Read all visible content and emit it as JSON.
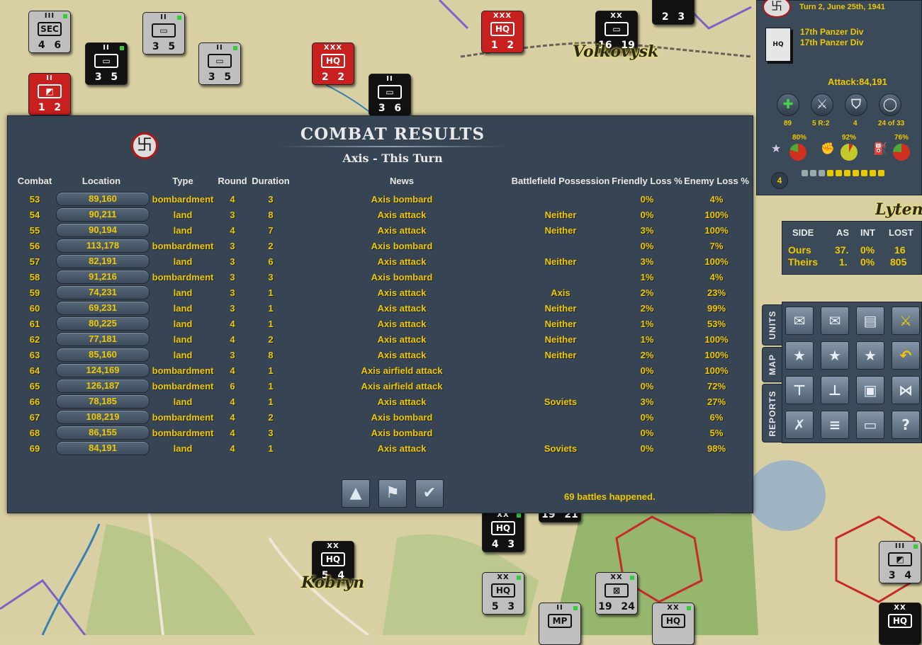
{
  "top_info": {
    "turn": "Turn 2, June 25th, 1941",
    "unit_line1": "17th Panzer Div",
    "unit_line2": "17th Panzer Div",
    "attack": "Attack:84,191",
    "stats": [
      {
        "icon": "medic-cross-icon",
        "value": "89"
      },
      {
        "icon": "crossed-swords-icon",
        "value": "5 R:2"
      },
      {
        "icon": "shield-icon",
        "value": "4"
      },
      {
        "icon": "circle-icon",
        "value": "24 of 33"
      }
    ],
    "pcts": [
      "80%",
      "92%",
      "76%"
    ],
    "count": "4"
  },
  "map": {
    "cities": [
      "Volkovysk",
      "Kobryn",
      "Lyten"
    ],
    "counters": [
      {
        "size": "III",
        "sym": "SEC",
        "nums": "4 6",
        "color": "grey"
      },
      {
        "size": "II",
        "sym": "▭",
        "nums": "3 5",
        "color": "grey"
      },
      {
        "size": "XXX",
        "sym": "HQ",
        "nums": "1 2",
        "color": "red"
      },
      {
        "size": "XX",
        "sym": "▭",
        "nums": "16 19",
        "color": "black"
      },
      {
        "size": "",
        "sym": "",
        "nums": "2 3",
        "color": "black"
      },
      {
        "size": "II",
        "sym": "▭",
        "nums": "3 5",
        "color": "black"
      },
      {
        "size": "II",
        "sym": "▭",
        "nums": "3 5",
        "color": "grey"
      },
      {
        "size": "XXX",
        "sym": "HQ",
        "nums": "2 2",
        "color": "red"
      },
      {
        "size": "II",
        "sym": "▭",
        "nums": "3 6",
        "color": "black"
      },
      {
        "size": "II",
        "sym": "◩",
        "nums": "1 2",
        "color": "red"
      },
      {
        "size": "XX",
        "sym": "HQ",
        "nums": "4 3",
        "color": "black"
      },
      {
        "size": "",
        "sym": "",
        "nums": "19 21",
        "color": "black"
      },
      {
        "size": "XX",
        "sym": "HQ",
        "nums": "5 4",
        "color": "black"
      },
      {
        "size": "XX",
        "sym": "HQ",
        "nums": "5 3",
        "color": "grey"
      },
      {
        "size": "II",
        "sym": "MP",
        "nums": "",
        "color": "grey"
      },
      {
        "size": "XX",
        "sym": "⊠",
        "nums": "19 24",
        "color": "grey"
      },
      {
        "size": "XX",
        "sym": "HQ",
        "nums": "",
        "color": "grey"
      },
      {
        "size": "III",
        "sym": "◩",
        "nums": "3 4",
        "color": "grey"
      },
      {
        "size": "XX",
        "sym": "HQ",
        "nums": "",
        "color": "black"
      }
    ]
  },
  "combat": {
    "title": "COMBAT RESULTS",
    "subtitle": "Axis - This Turn",
    "headers": [
      "Combat",
      "Location",
      "Type",
      "Round",
      "Duration",
      "News",
      "Battlefield Possession",
      "Friendly Loss %",
      "Enemy Loss %"
    ],
    "rows": [
      [
        "53",
        "89,160",
        "bombardment",
        "4",
        "3",
        "Axis bombard",
        "",
        "0%",
        "4%"
      ],
      [
        "54",
        "90,211",
        "land",
        "3",
        "8",
        "Axis attack",
        "Neither",
        "0%",
        "100%"
      ],
      [
        "55",
        "90,194",
        "land",
        "4",
        "7",
        "Axis attack",
        "Neither",
        "3%",
        "100%"
      ],
      [
        "56",
        "113,178",
        "bombardment",
        "3",
        "2",
        "Axis bombard",
        "",
        "0%",
        "7%"
      ],
      [
        "57",
        "82,191",
        "land",
        "3",
        "6",
        "Axis attack",
        "Neither",
        "3%",
        "100%"
      ],
      [
        "58",
        "91,216",
        "bombardment",
        "3",
        "3",
        "Axis bombard",
        "",
        "1%",
        "4%"
      ],
      [
        "59",
        "74,231",
        "land",
        "3",
        "1",
        "Axis attack",
        "Axis",
        "2%",
        "23%"
      ],
      [
        "60",
        "69,231",
        "land",
        "3",
        "1",
        "Axis attack",
        "Neither",
        "2%",
        "99%"
      ],
      [
        "61",
        "80,225",
        "land",
        "4",
        "1",
        "Axis attack",
        "Neither",
        "1%",
        "53%"
      ],
      [
        "62",
        "77,181",
        "land",
        "4",
        "2",
        "Axis attack",
        "Neither",
        "1%",
        "100%"
      ],
      [
        "63",
        "85,160",
        "land",
        "3",
        "8",
        "Axis attack",
        "Neither",
        "2%",
        "100%"
      ],
      [
        "64",
        "124,169",
        "bombardment",
        "4",
        "1",
        "Axis airfield attack",
        "",
        "0%",
        "100%"
      ],
      [
        "65",
        "126,187",
        "bombardment",
        "6",
        "1",
        "Axis airfield attack",
        "",
        "0%",
        "72%"
      ],
      [
        "66",
        "78,185",
        "land",
        "4",
        "1",
        "Axis attack",
        "Soviets",
        "3%",
        "27%"
      ],
      [
        "67",
        "108,219",
        "bombardment",
        "4",
        "2",
        "Axis bombard",
        "",
        "0%",
        "6%"
      ],
      [
        "68",
        "86,155",
        "bombardment",
        "4",
        "3",
        "Axis bombard",
        "",
        "0%",
        "5%"
      ],
      [
        "69",
        "84,191",
        "land",
        "4",
        "1",
        "Axis attack",
        "Soviets",
        "0%",
        "98%"
      ]
    ],
    "footer": "69 battles happened.",
    "buttons": [
      {
        "name": "scroll-up-button",
        "icon": "up-arrow-icon"
      },
      {
        "name": "flag-button",
        "icon": "flag-icon"
      },
      {
        "name": "confirm-button",
        "icon": "checkmark-icon"
      }
    ]
  },
  "side_table": {
    "headers": [
      "SIDE",
      "AS",
      "INT",
      "LOST"
    ],
    "rows": [
      [
        "Ours",
        "37.",
        "0%",
        "16"
      ],
      [
        "Theirs",
        "1.",
        "0%",
        "805"
      ]
    ]
  },
  "tabs": [
    "UNITS",
    "MAP",
    "REPORTS"
  ],
  "toolbar_icons": [
    "prev-unit-icon",
    "next-unit-icon",
    "supply-icon",
    "attack-mode-icon",
    "prev-star-icon",
    "next-star-icon",
    "star-icon",
    "undo-icon",
    "org-chart-icon",
    "hierarchy-icon",
    "hq-icon",
    "divisions-icon",
    "disband-icon",
    "report-icon",
    "message-icon",
    "help-icon"
  ],
  "colors": {
    "panel": "#364453",
    "text_yellow": "#f0c800",
    "axis_red": "#c8201e"
  }
}
